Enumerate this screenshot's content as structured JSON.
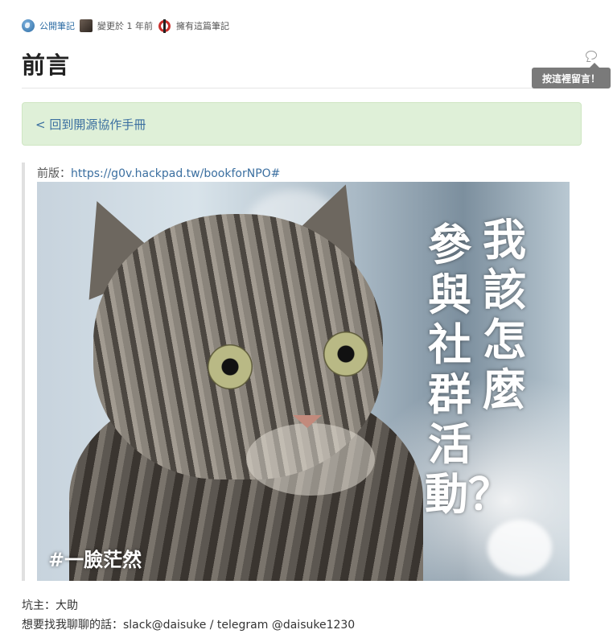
{
  "meta": {
    "public_label": "公開筆記",
    "changed_label": "變更於 1 年前",
    "owner_label": "擁有這篇筆記"
  },
  "page": {
    "title": "前言"
  },
  "comment": {
    "tooltip": "按這裡留言！"
  },
  "back_link": {
    "label": "< 回到開源協作手冊"
  },
  "quote": {
    "prev_prefix": "前版：",
    "prev_url": "https://g0v.hackpad.tw/bookforNPO#"
  },
  "image": {
    "col1": "我該怎麼",
    "col2": "參與社群活動？",
    "hashtag": "#一臉茫然"
  },
  "author": {
    "line1": "坑主：大助",
    "line2": "想要找我聊聊的話：slack@daisuke / telegram @daisuke1230"
  }
}
